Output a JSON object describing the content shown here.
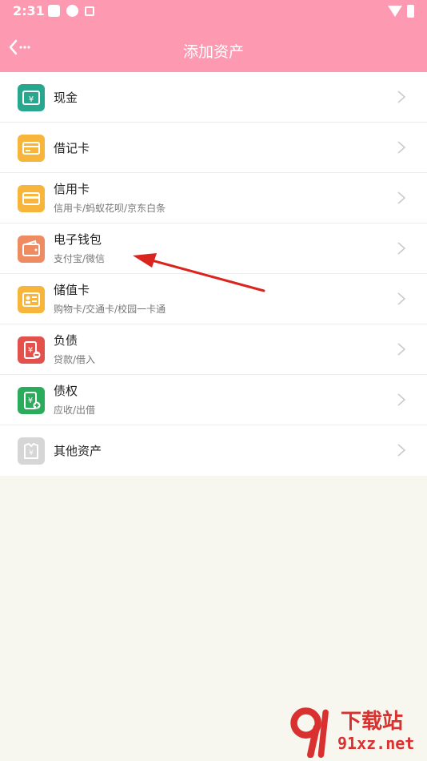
{
  "status_bar": {
    "time": "2:31"
  },
  "header": {
    "title": "添加资产"
  },
  "items": [
    {
      "title": "现金",
      "subtitle": "",
      "icon": "cash-icon",
      "color": "#27a88e"
    },
    {
      "title": "借记卡",
      "subtitle": "",
      "icon": "debit-card-icon",
      "color": "#f7b53b"
    },
    {
      "title": "信用卡",
      "subtitle": "信用卡/蚂蚁花呗/京东白条",
      "icon": "credit-card-icon",
      "color": "#f7b53b"
    },
    {
      "title": "电子钱包",
      "subtitle": "支付宝/微信",
      "icon": "wallet-icon",
      "color": "#ef8b61"
    },
    {
      "title": "储值卡",
      "subtitle": "购物卡/交通卡/校园一卡通",
      "icon": "stored-value-card-icon",
      "color": "#f7b53b"
    },
    {
      "title": "负债",
      "subtitle": "贷款/借入",
      "icon": "debt-icon",
      "color": "#e2514c"
    },
    {
      "title": "债权",
      "subtitle": "应收/出借",
      "icon": "claim-icon",
      "color": "#2bab5c"
    },
    {
      "title": "其他资产",
      "subtitle": "",
      "icon": "other-assets-icon",
      "color": "#d6d6d6"
    }
  ],
  "watermark": {
    "brand": "下载站",
    "url": "91xz.net"
  },
  "colors": {
    "header": "#fd9ab2",
    "background": "#f8f7ef",
    "annotation_arrow": "#d9251d"
  }
}
